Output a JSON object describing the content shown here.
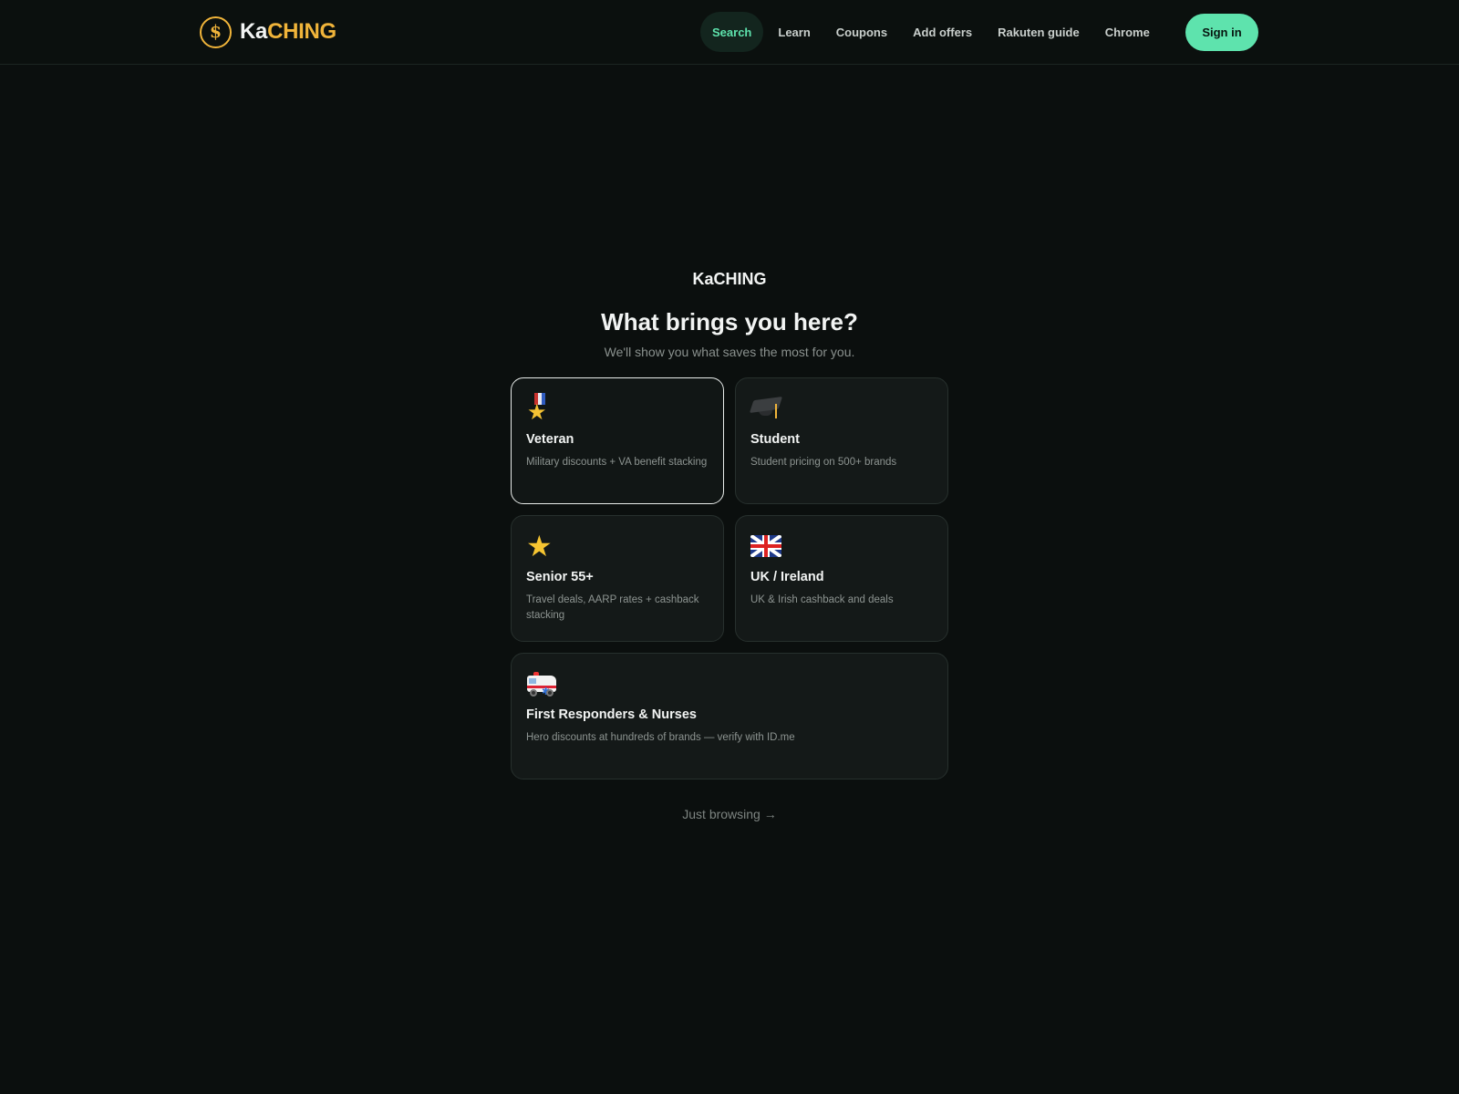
{
  "header": {
    "brand_prefix": "Ka",
    "brand_suffix": "CHING",
    "logo_symbol": "$",
    "nav": [
      {
        "label": "Search",
        "active": true
      },
      {
        "label": "Learn"
      },
      {
        "label": "Coupons"
      },
      {
        "label": "Add offers"
      },
      {
        "label": "Rakuten guide"
      },
      {
        "label": "Chrome"
      }
    ],
    "signin_label": "Sign in"
  },
  "onboarding": {
    "brand": "KaCHING",
    "headline": "What brings you here?",
    "subtitle": "We'll show you what saves the most for you.",
    "options": [
      {
        "icon": "military-medal-icon",
        "title": "Veteran",
        "desc": "Military discounts + VA benefit stacking",
        "selected": true
      },
      {
        "icon": "graduation-cap-icon",
        "title": "Student",
        "desc": "Student pricing on 500+ brands"
      },
      {
        "icon": "star-icon",
        "title": "Senior 55+",
        "desc": "Travel deals, AARP rates + cashback stacking"
      },
      {
        "icon": "uk-flag-icon",
        "title": "UK / Ireland",
        "desc": "UK & Irish cashback and deals"
      },
      {
        "icon": "ambulance-icon",
        "title": "First Responders & Nurses",
        "desc": "Hero discounts at hundreds of brands — verify with ID.me"
      }
    ],
    "skip_label": "Just browsing →"
  },
  "colors": {
    "background": "#0b0f0e",
    "accent": "#5ee3ad",
    "brand_gold": "#f0b43a"
  }
}
